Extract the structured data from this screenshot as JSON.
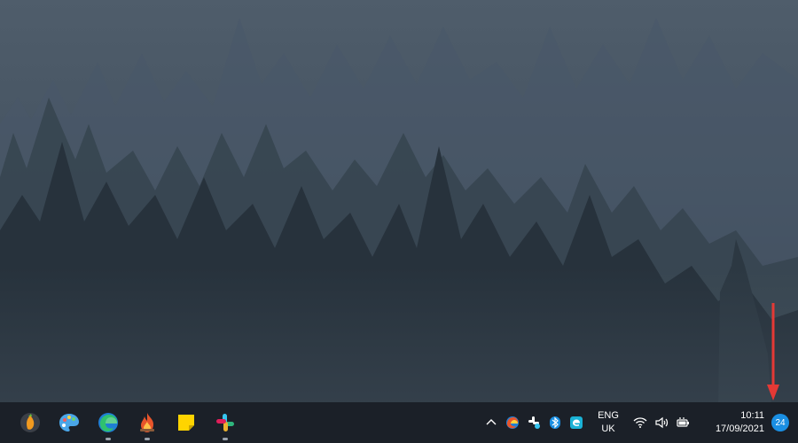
{
  "taskbar": {
    "pinned_apps": [
      {
        "icon": "fl-studio-icon",
        "running": false
      },
      {
        "icon": "paint-palette-icon",
        "running": false
      },
      {
        "icon": "edge-browser-icon",
        "running": true
      },
      {
        "icon": "fire-app-icon",
        "running": true
      },
      {
        "icon": "sticky-notes-icon",
        "running": false
      },
      {
        "icon": "slack-icon",
        "running": true
      }
    ],
    "tray": {
      "icons": [
        "chevron-up-icon",
        "edge-tray-icon",
        "slack-tray-icon",
        "bluetooth-icon",
        "edge-legacy-icon"
      ],
      "language": {
        "line1": "ENG",
        "line2": "UK"
      },
      "status_icons": [
        "wifi-icon",
        "volume-icon",
        "battery-icon"
      ],
      "clock": {
        "time": "10:11",
        "date": "17/09/2021"
      },
      "notification_count": "24"
    }
  },
  "colors": {
    "taskbar_bg": "#1b2028",
    "badge": "#1a8fe3",
    "annotation_arrow": "#e53935"
  }
}
